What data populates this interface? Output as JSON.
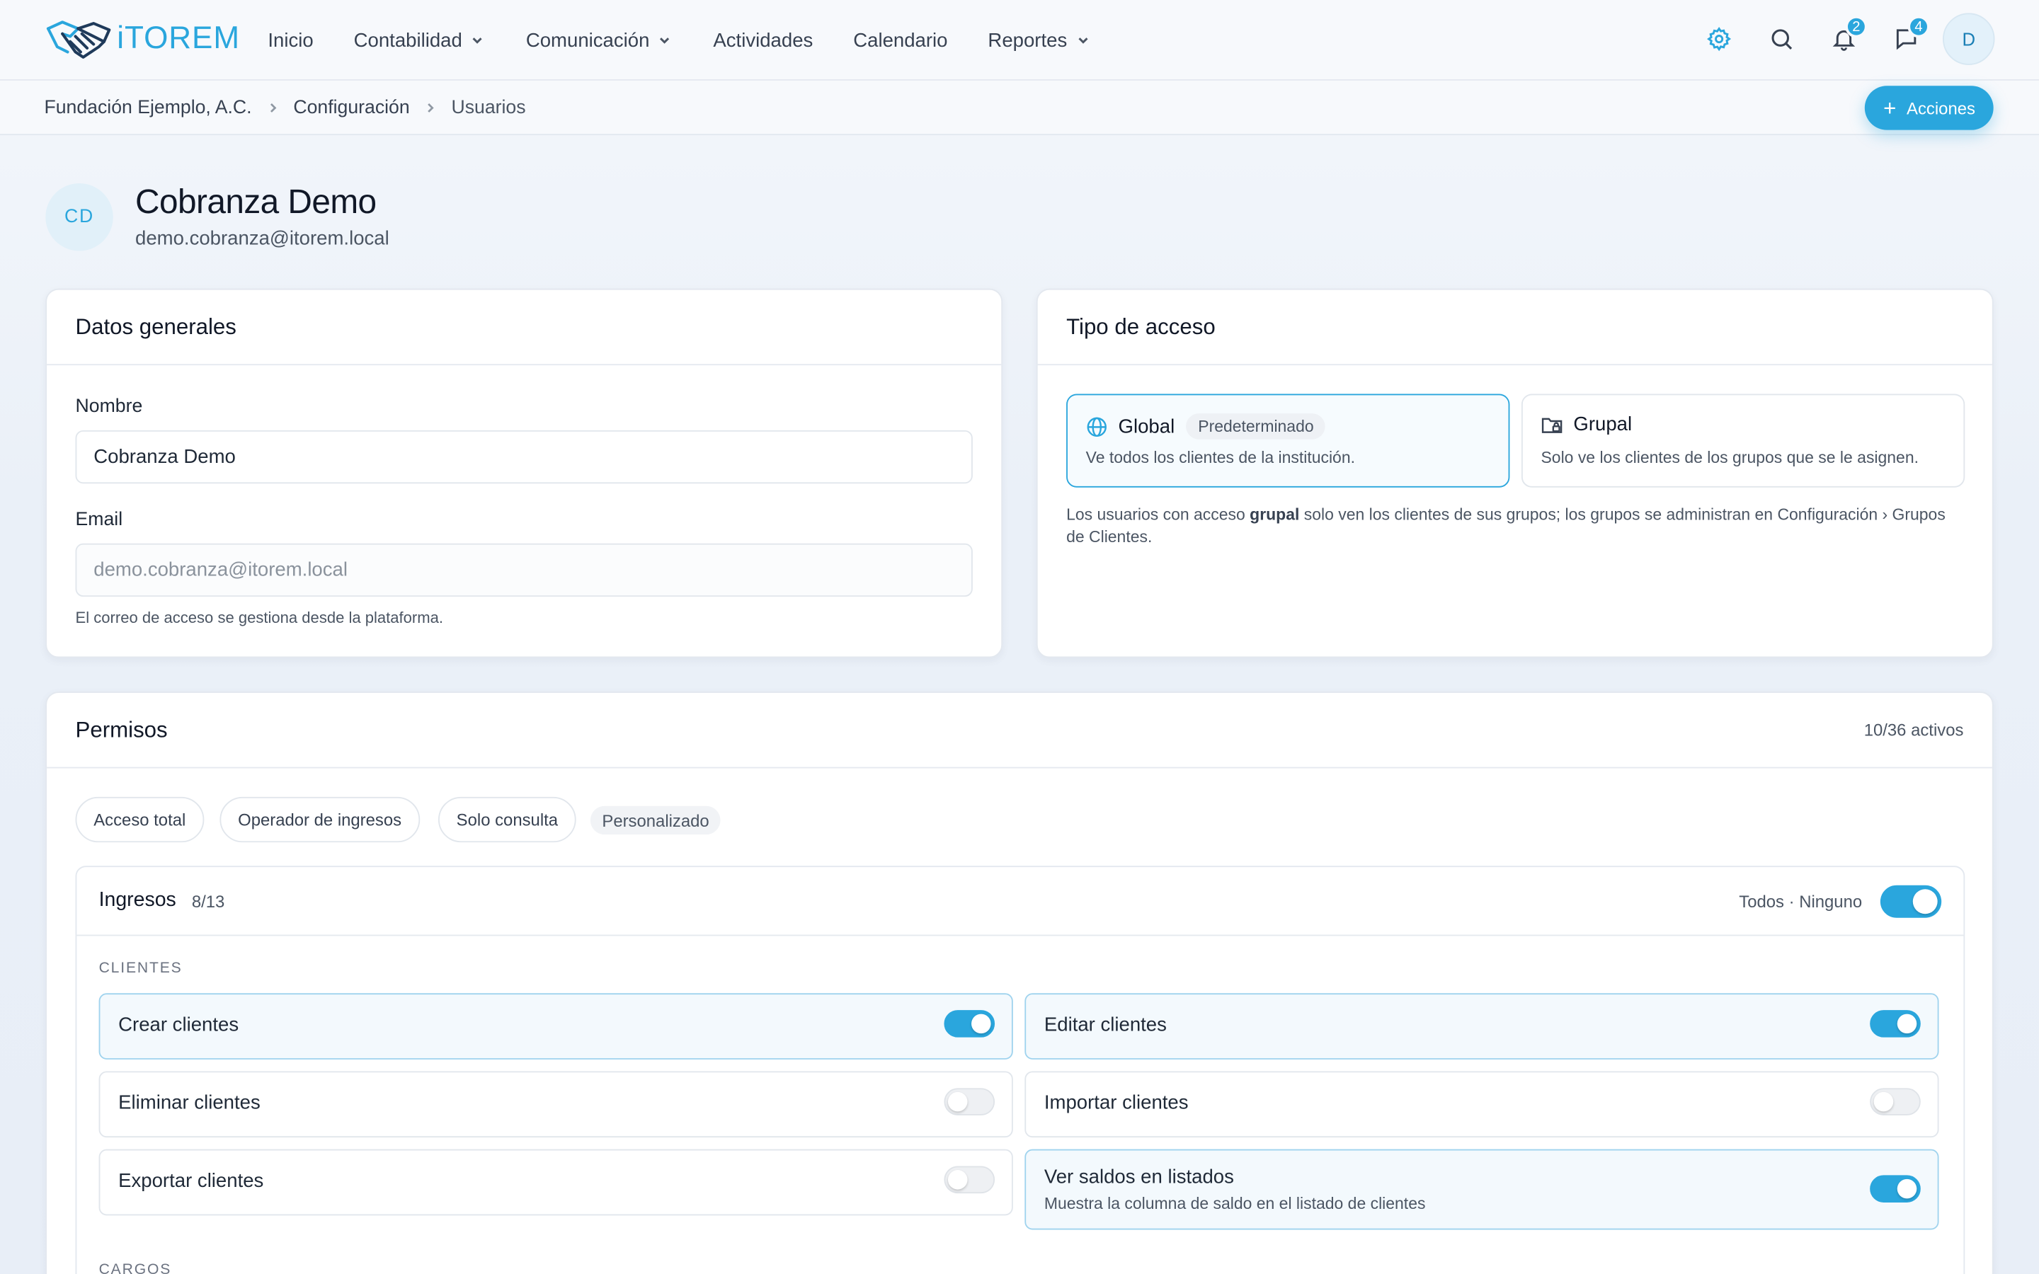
{
  "app": {
    "logo_text": "iTOREM"
  },
  "nav": {
    "items": [
      {
        "label": "Inicio",
        "dropdown": false
      },
      {
        "label": "Contabilidad",
        "dropdown": true
      },
      {
        "label": "Comunicación",
        "dropdown": true
      },
      {
        "label": "Actividades",
        "dropdown": false
      },
      {
        "label": "Calendario",
        "dropdown": false
      },
      {
        "label": "Reportes",
        "dropdown": true
      }
    ],
    "notifications_count": "2",
    "messages_count": "4",
    "avatar_initial": "D"
  },
  "breadcrumb": [
    "Fundación Ejemplo, A.C.",
    "Configuración",
    "Usuarios"
  ],
  "actions_label": "Acciones",
  "user": {
    "initials": "CD",
    "name": "Cobranza Demo",
    "email": "demo.cobranza@itorem.local"
  },
  "general": {
    "title": "Datos generales",
    "name_label": "Nombre",
    "name_value": "Cobranza Demo",
    "email_label": "Email",
    "email_value": "demo.cobranza@itorem.local",
    "email_hint": "El correo de acceso se gestiona desde la plataforma."
  },
  "access": {
    "title": "Tipo de acceso",
    "options": [
      {
        "name": "Global",
        "badge": "Predeterminado",
        "desc": "Ve todos los clientes de la institución.",
        "selected": true,
        "icon": "globe-icon"
      },
      {
        "name": "Grupal",
        "badge": "",
        "desc": "Solo ve los clientes de los grupos que se le asignen.",
        "selected": false,
        "icon": "folder-lock-icon"
      }
    ],
    "note_before": "Los usuarios con acceso ",
    "note_bold": "grupal",
    "note_after": " solo ven los clientes de sus grupos; los grupos se administran en Configuración › Grupos de Clientes."
  },
  "permissions": {
    "title": "Permisos",
    "active_count": "10/36 activos",
    "presets": [
      "Acceso total",
      "Operador de ingresos",
      "Solo consulta",
      "Personalizado"
    ],
    "active_preset": "Personalizado",
    "section": {
      "title": "Ingresos",
      "count": "8/13",
      "links": "Todos · Ninguno",
      "enabled": true,
      "groups": [
        {
          "label": "CLIENTES",
          "items": [
            {
              "label": "Crear clientes",
              "desc": "",
              "on": true
            },
            {
              "label": "Editar clientes",
              "desc": "",
              "on": true
            },
            {
              "label": "Eliminar clientes",
              "desc": "",
              "on": false
            },
            {
              "label": "Importar clientes",
              "desc": "",
              "on": false
            },
            {
              "label": "Exportar clientes",
              "desc": "",
              "on": false
            },
            {
              "label": "Ver saldos en listados",
              "desc": "Muestra la columna de saldo en el listado de clientes",
              "on": true
            }
          ]
        },
        {
          "label": "CARGOS",
          "items": []
        }
      ]
    }
  },
  "colors": {
    "accent": "#2aa6dd",
    "text": "#1f2937",
    "muted": "#4b5563"
  }
}
